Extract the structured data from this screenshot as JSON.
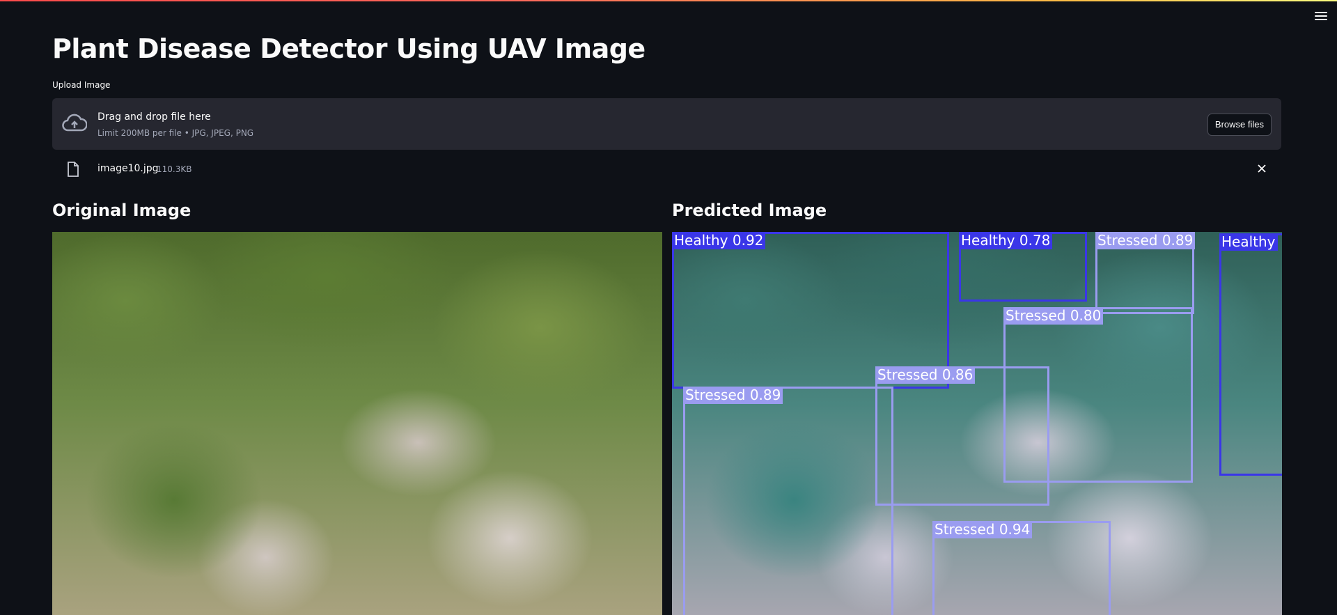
{
  "app": {
    "title": "Plant Disease Detector Using UAV Image"
  },
  "uploader": {
    "label": "Upload Image",
    "drop_text": "Drag and drop file here",
    "limit_text": "Limit 200MB per file • JPG, JPEG, PNG",
    "browse_label": "Browse files",
    "icon": "cloud-upload-icon"
  },
  "file": {
    "name": "image10.jpg",
    "size": "110.3KB",
    "icon": "file-icon"
  },
  "columns": {
    "original_title": "Original Image",
    "predicted_title": "Predicted Image"
  },
  "detections": [
    {
      "label": "Healthy 0.92",
      "class": "Healthy",
      "color": "#3a36e8"
    },
    {
      "label": "Healthy 0.78",
      "class": "Healthy",
      "color": "#3a36e8"
    },
    {
      "label": "Stressed 0.89",
      "class": "Stressed",
      "color": "#9a9cf0"
    },
    {
      "label": "Healthy",
      "class": "Healthy",
      "color": "#3a36e8"
    },
    {
      "label": "Stressed 0.80",
      "class": "Stressed",
      "color": "#9a9cf0"
    },
    {
      "label": "Stressed 0.86",
      "class": "Stressed",
      "color": "#9a9cf0"
    },
    {
      "label": "Stressed 0.89",
      "class": "Stressed",
      "color": "#9a9cf0"
    },
    {
      "label": "Stressed 0.94",
      "class": "Stressed",
      "color": "#9a9cf0"
    }
  ],
  "colors": {
    "background": "#0e1117",
    "dropzone": "#262730",
    "healthy_box": "#3a36e8",
    "stressed_box": "#9a9cf0"
  }
}
